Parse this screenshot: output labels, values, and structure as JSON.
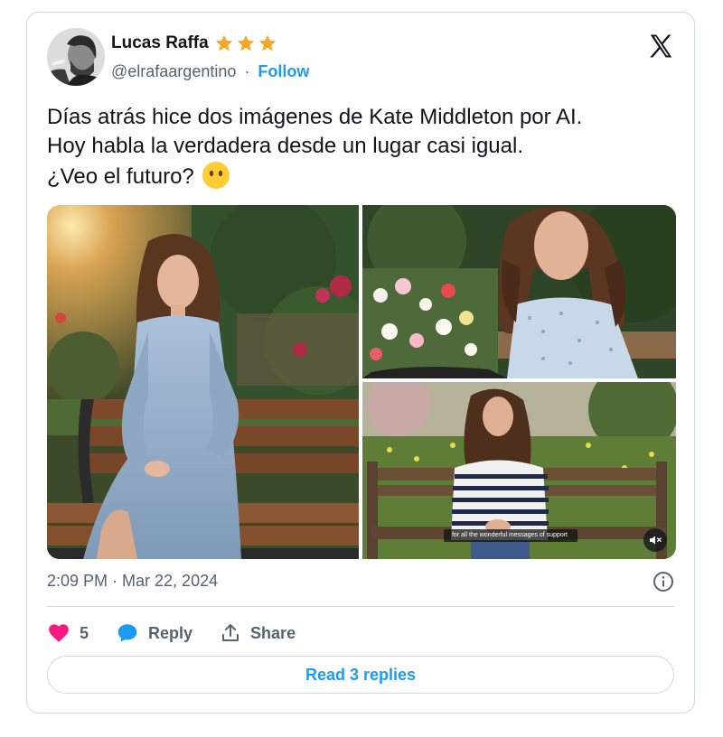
{
  "author": {
    "name": "Lucas Raffa",
    "handle": "@elrafaargentino",
    "separator": "·",
    "follow_label": "Follow",
    "avatar_icon": "avatar-photo",
    "badge_icons": [
      "star-icon",
      "star-icon",
      "star-icon"
    ],
    "star_color": "#f5a623"
  },
  "tweet": {
    "lines": [
      "Días atrás hice dos imágenes de Kate Middleton por AI.",
      "Hoy habla la verdadera desde un lugar casi igual.",
      "¿Veo el futuro?"
    ],
    "emoji": "face-without-mouth-emoji",
    "timestamp": "2:09 PM · Mar 22, 2024"
  },
  "media": {
    "count": 3,
    "video_caption": "for all the wonderful messages of support",
    "video_icon": "mute-speaker-icon"
  },
  "actions": {
    "like_count": "5",
    "reply_label": "Reply",
    "share_label": "Share",
    "like_color": "#f91880",
    "reply_color": "#1d9bf0"
  },
  "footer": {
    "read_replies_label": "Read 3 replies"
  },
  "colors": {
    "accent": "#1d9bf0",
    "muted": "#536471",
    "border": "#cfd9de"
  }
}
